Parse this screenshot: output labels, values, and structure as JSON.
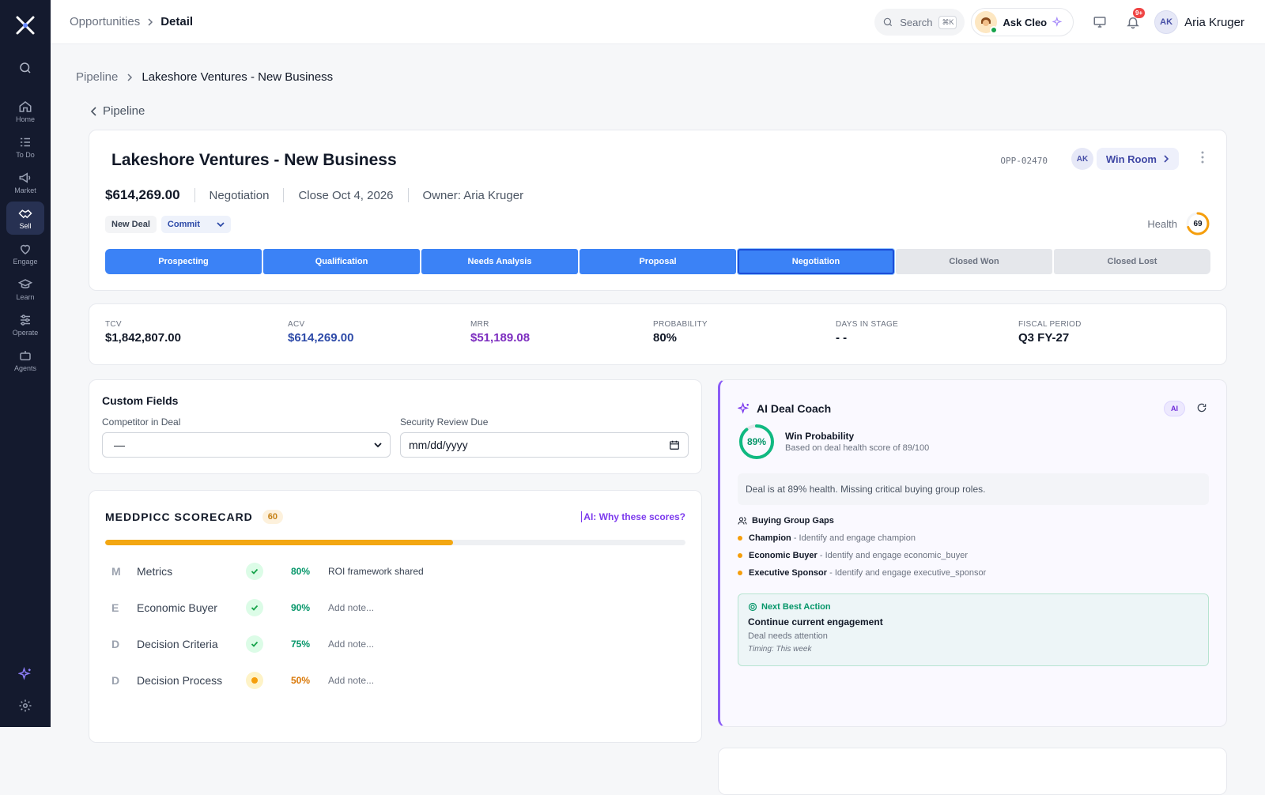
{
  "topbar": {
    "crumb_parent": "Opportunities",
    "crumb_current": "Detail",
    "search_label": "Search",
    "search_kbd": "⌘K",
    "ask": "Ask Cleo",
    "notif_badge": "9+",
    "user_initials": "AK",
    "user_name": "Aria Kruger"
  },
  "sidebar": {
    "items": [
      {
        "label": "Home",
        "icon": "home-icon"
      },
      {
        "label": "To Do",
        "icon": "todo-icon"
      },
      {
        "label": "Market",
        "icon": "megaphone-icon"
      },
      {
        "label": "Sell",
        "icon": "handshake-icon",
        "active": true
      },
      {
        "label": "Engage",
        "icon": "heart-icon"
      },
      {
        "label": "Learn",
        "icon": "graduation-icon"
      },
      {
        "label": "Operate",
        "icon": "sliders-icon"
      },
      {
        "label": "Agents",
        "icon": "robot-icon"
      }
    ]
  },
  "page": {
    "crumb_parent": "Pipeline",
    "crumb_current": "Lakeshore Ventures - New Business",
    "back_label": "Pipeline"
  },
  "deal": {
    "title": "Lakeshore Ventures - New Business",
    "amount": "$614,269.00",
    "stage": "Negotiation",
    "close": "Close Oct 4, 2026",
    "owner": "Owner: Aria Kruger",
    "opp_id": "OPP-02470",
    "owner_initials": "AK",
    "win_room": "Win Room",
    "tag_new": "New Deal",
    "forecast": "Commit",
    "health_label": "Health",
    "health_value": "69",
    "health_fraction": 0.69
  },
  "stages": [
    {
      "label": "Prospecting",
      "state": "done"
    },
    {
      "label": "Qualification",
      "state": "done"
    },
    {
      "label": "Needs Analysis",
      "state": "done"
    },
    {
      "label": "Proposal",
      "state": "done"
    },
    {
      "label": "Negotiation",
      "state": "cur"
    },
    {
      "label": "Closed Won",
      "state": "todo"
    },
    {
      "label": "Closed Lost",
      "state": "todo"
    }
  ],
  "metrics": [
    {
      "k": "TCV",
      "v": "$1,842,807.00",
      "color": "#111827"
    },
    {
      "k": "ACV",
      "v": "$614,269.00",
      "color": "#2d4aa8"
    },
    {
      "k": "MRR",
      "v": "$51,189.08",
      "color": "#7c2dbf"
    },
    {
      "k": "PROBABILITY",
      "v": "80%",
      "color": "#111827"
    },
    {
      "k": "DAYS IN STAGE",
      "v": "- -",
      "color": "#111827"
    },
    {
      "k": "FISCAL PERIOD",
      "v": "Q3 FY-27",
      "color": "#111827"
    }
  ],
  "custom_fields": {
    "title": "Custom Fields",
    "competitor_label": "Competitor in Deal",
    "competitor_value": "—",
    "security_label": "Security Review Due",
    "security_value": "mm/dd/yyyy"
  },
  "meddpicc": {
    "title": "MEDDPICC SCORECARD",
    "score": "60",
    "score_fraction": 0.6,
    "why": "AI: Why these scores?",
    "rows": [
      {
        "letter": "M",
        "name": "Metrics",
        "status": "ok",
        "pct": "80%",
        "pct_color": "#059669",
        "note": "ROI framework shared",
        "filled": true
      },
      {
        "letter": "E",
        "name": "Economic Buyer",
        "status": "ok",
        "pct": "90%",
        "pct_color": "#059669",
        "note": "Add note...",
        "filled": false
      },
      {
        "letter": "D",
        "name": "Decision Criteria",
        "status": "ok",
        "pct": "75%",
        "pct_color": "#059669",
        "note": "Add note...",
        "filled": false
      },
      {
        "letter": "D",
        "name": "Decision Process",
        "status": "warn",
        "pct": "50%",
        "pct_color": "#d97706",
        "note": "Add note...",
        "filled": false
      }
    ]
  },
  "coach": {
    "title": "AI Deal Coach",
    "ai_pill": "AI",
    "win_pct": "89%",
    "win_fraction": 0.89,
    "win_title": "Win Probability",
    "win_sub": "Based on deal health score of 89/100",
    "message": "Deal is at 89% health. Missing critical buying group roles.",
    "gaps_title": "Buying Group Gaps",
    "gaps": [
      {
        "role": "Champion",
        "text": " - Identify and engage champion"
      },
      {
        "role": "Economic Buyer",
        "text": " - Identify and engage economic_buyer"
      },
      {
        "role": "Executive Sponsor",
        "text": " - Identify and engage executive_sponsor"
      }
    ],
    "nba_header": "Next Best Action",
    "nba_title": "Continue current engagement",
    "nba_sub": "Deal needs attention",
    "nba_timing": "Timing: This week"
  }
}
